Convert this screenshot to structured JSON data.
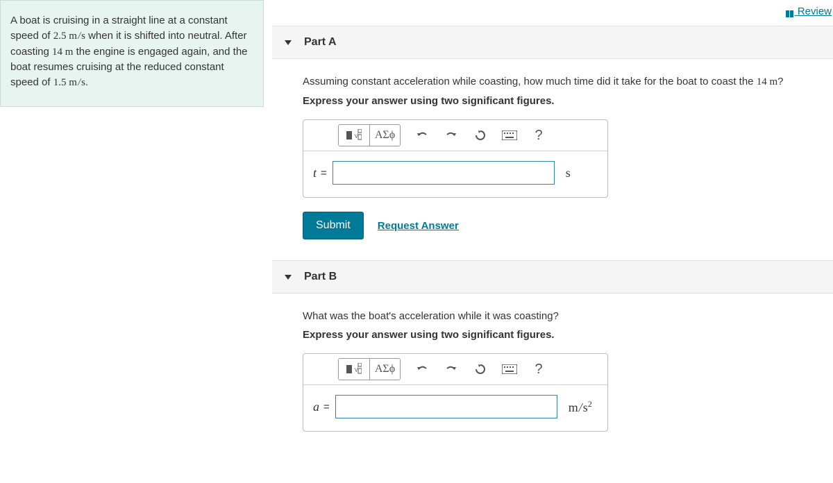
{
  "review_link": "Review",
  "problem_text": "A boat is cruising in a straight line at a constant speed of 2.5 m/s when it is shifted into neutral. After coasting 14 m the engine is engaged again, and the boat resumes cruising at the reduced constant speed of 1.5 m/s.",
  "problem_values": {
    "v1": "2.5",
    "d": "14",
    "v2": "1.5"
  },
  "parts": {
    "a": {
      "title": "Part A",
      "question": "Assuming constant acceleration while coasting, how much time did it take for the boat to coast the 14 m?",
      "instruction": "Express your answer using two significant figures.",
      "variable": "t",
      "units": "s",
      "greek_btn": "ΑΣϕ",
      "submit": "Submit",
      "request": "Request Answer"
    },
    "b": {
      "title": "Part B",
      "question": "What was the boat's acceleration while it was coasting?",
      "instruction": "Express your answer using two significant figures.",
      "variable": "a",
      "units_html": "m/s²",
      "greek_btn": "ΑΣϕ"
    }
  }
}
